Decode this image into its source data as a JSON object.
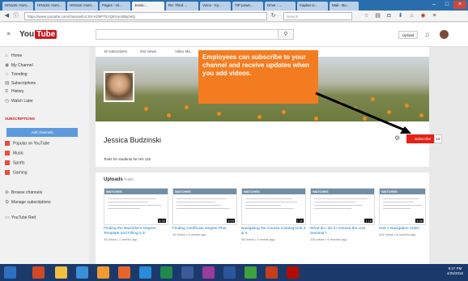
{
  "browser": {
    "tabs": [
      {
        "label": "HIN115: Hum..."
      },
      {
        "label": "HIN115: Hum..."
      },
      {
        "label": "HIN115: Hum..."
      },
      {
        "label": "Pages - Hi..."
      },
      {
        "label": "Jessic..."
      },
      {
        "label": "Re: Third ..."
      },
      {
        "label": "Voice - Ky..."
      },
      {
        "label": "TIP powe..."
      },
      {
        "label": "Drive - ..."
      },
      {
        "label": "Kaplan U..."
      },
      {
        "label": "Mail - Bu..."
      }
    ],
    "url": "https://www.youtube.com/channel/UC0X-KZ9P7tCrQEmyVB5jcMQ",
    "search_placeholder": "Search"
  },
  "youtube": {
    "logo_left": "You",
    "logo_right": "Tube",
    "upload_label": "Upload",
    "sidebar": {
      "items": [
        {
          "label": "Home",
          "icon": "home-icon"
        },
        {
          "label": "My Channel",
          "icon": "person-icon"
        },
        {
          "label": "Trending",
          "icon": "flame-icon"
        },
        {
          "label": "Subscriptions",
          "icon": "subscriptions-icon"
        },
        {
          "label": "History",
          "icon": "hourglass-icon"
        },
        {
          "label": "Watch Later",
          "icon": "clock-icon"
        }
      ],
      "subscriptions_heading": "SUBSCRIPTIONS",
      "add_channels": "Add channels",
      "channels": [
        {
          "label": "Popular on YouTube",
          "color": "#e74c3c"
        },
        {
          "label": "Music",
          "color": "#e74c3c"
        },
        {
          "label": "Sports",
          "color": "#e74c3c"
        },
        {
          "label": "Gaming",
          "color": "#e74c3c"
        }
      ],
      "browse_channels": "Browse channels",
      "manage_subscriptions": "Manage subscriptions",
      "youtube_red": "YouTube Red"
    },
    "channel": {
      "stats": [
        "19 subscribers",
        "842 views",
        "Video Ma..."
      ],
      "name": "Jessica Budzinski",
      "description": "Tools for students for HN 115",
      "subscribe_label": "Subscribe",
      "subscriber_count": "19",
      "callout": "Employees can subscribe to your channel and receive updates when you add videos."
    },
    "uploads": {
      "heading": "Uploads",
      "visibility": "Public",
      "videos": [
        {
          "title": "Finding the Bachelor's Degree Template and Filling it in",
          "meta": "39 views • 2 weeks ago",
          "duration": "4:33"
        },
        {
          "title": "Finding Certificate Degree Plan",
          "meta": "16 views • 3 weeks ago",
          "duration": "2:04"
        },
        {
          "title": "Navigating the Course Catalog-Unit 3 & 4",
          "meta": "58 views • 3 weeks ago",
          "duration": "7:11"
        },
        {
          "title": "What do I do if I missed the Live Seminar?",
          "meta": "235 views • 9 months ago",
          "duration": "1:16"
        },
        {
          "title": "Unit 1 Navigation Video",
          "meta": "402 views • 6 months ago",
          "duration": "4:06"
        }
      ],
      "watermark": "WATCHES"
    }
  },
  "taskbar": {
    "time": "9:27 PM",
    "date": "4/25/2016"
  },
  "colors": {
    "accent": "#f47c20",
    "subscribe": "#e62117",
    "link": "#167ac6"
  }
}
